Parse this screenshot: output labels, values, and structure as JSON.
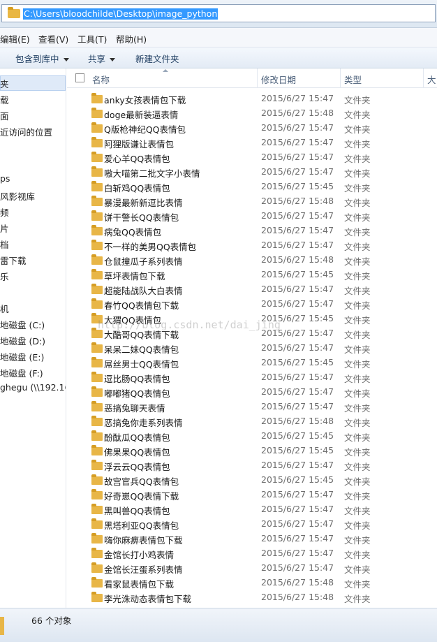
{
  "address": {
    "path": "C:\\Users\\bloodchilde\\Desktop\\image_python"
  },
  "menubar": {
    "items": [
      "编辑(E)",
      "查看(V)",
      "工具(T)",
      "帮助(H)"
    ]
  },
  "toolbar": {
    "include_library": "包含到库中",
    "share": "共享",
    "new_folder": "新建文件夹"
  },
  "navpane": {
    "items": [
      "夹",
      "载",
      "面",
      "近访问的位置",
      "ps",
      "风影视库",
      "频",
      "片",
      "档",
      "雷下载",
      "乐",
      "机",
      "地磁盘 (C:)",
      "地磁盘 (D:)",
      "地磁盘 (E:)",
      "地磁盘 (F:)",
      "ghegu (\\\\192.16"
    ]
  },
  "columns": {
    "name": "名称",
    "date": "修改日期",
    "type": "类型",
    "size": "大"
  },
  "files": [
    {
      "name": "anky女孩表情包下载",
      "date": "2015/6/27 15:47",
      "type": "文件夹"
    },
    {
      "name": "doge最新装逼表情",
      "date": "2015/6/27 15:48",
      "type": "文件夹"
    },
    {
      "name": "Q版枪神纪QQ表情包",
      "date": "2015/6/27 15:47",
      "type": "文件夹"
    },
    {
      "name": "阿狸版谦让表情包",
      "date": "2015/6/27 15:47",
      "type": "文件夹"
    },
    {
      "name": "爱心羊QQ表情包",
      "date": "2015/6/27 15:47",
      "type": "文件夹"
    },
    {
      "name": "嗷大喵第二批文字小表情",
      "date": "2015/6/27 15:47",
      "type": "文件夹"
    },
    {
      "name": "白斩鸡QQ表情包",
      "date": "2015/6/27 15:45",
      "type": "文件夹"
    },
    {
      "name": "暴漫最新新逗比表情",
      "date": "2015/6/27 15:48",
      "type": "文件夹"
    },
    {
      "name": "饼干警长QQ表情包",
      "date": "2015/6/27 15:47",
      "type": "文件夹"
    },
    {
      "name": "病兔QQ表情包",
      "date": "2015/6/27 15:47",
      "type": "文件夹"
    },
    {
      "name": "不一样的美男QQ表情包",
      "date": "2015/6/27 15:47",
      "type": "文件夹"
    },
    {
      "name": "仓鼠撞瓜子系列表情",
      "date": "2015/6/27 15:48",
      "type": "文件夹"
    },
    {
      "name": "草坪表情包下载",
      "date": "2015/6/27 15:45",
      "type": "文件夹"
    },
    {
      "name": "超能陆战队大白表情",
      "date": "2015/6/27 15:47",
      "type": "文件夹"
    },
    {
      "name": "春竹QQ表情包下载",
      "date": "2015/6/27 15:47",
      "type": "文件夹"
    },
    {
      "name": "大猬QQ表情包",
      "date": "2015/6/27 15:45",
      "type": "文件夹"
    },
    {
      "name": "大酷哥QQ表情下载",
      "date": "2015/6/27 15:47",
      "type": "文件夹"
    },
    {
      "name": "呆呆二妹QQ表情包",
      "date": "2015/6/27 15:47",
      "type": "文件夹"
    },
    {
      "name": "屌丝男士QQ表情包",
      "date": "2015/6/27 15:45",
      "type": "文件夹"
    },
    {
      "name": "逗比肠QQ表情包",
      "date": "2015/6/27 15:47",
      "type": "文件夹"
    },
    {
      "name": "嘟嘟猪QQ表情包",
      "date": "2015/6/27 15:47",
      "type": "文件夹"
    },
    {
      "name": "恶搞兔聊天表情",
      "date": "2015/6/27 15:47",
      "type": "文件夹"
    },
    {
      "name": "恶搞兔你走系列表情",
      "date": "2015/6/27 15:48",
      "type": "文件夹"
    },
    {
      "name": "酚酞瓜QQ表情包",
      "date": "2015/6/27 15:45",
      "type": "文件夹"
    },
    {
      "name": "佛果果QQ表情包",
      "date": "2015/6/27 15:45",
      "type": "文件夹"
    },
    {
      "name": "浮云云QQ表情包",
      "date": "2015/6/27 15:47",
      "type": "文件夹"
    },
    {
      "name": "故宫官兵QQ表情包",
      "date": "2015/6/27 15:45",
      "type": "文件夹"
    },
    {
      "name": "好奇崽QQ表情下载",
      "date": "2015/6/27 15:47",
      "type": "文件夹"
    },
    {
      "name": "黑叫兽QQ表情包",
      "date": "2015/6/27 15:47",
      "type": "文件夹"
    },
    {
      "name": "黑塔利亚QQ表情包",
      "date": "2015/6/27 15:47",
      "type": "文件夹"
    },
    {
      "name": "嗨你麻痹表情包下载",
      "date": "2015/6/27 15:47",
      "type": "文件夹"
    },
    {
      "name": "金馆长打小鸡表情",
      "date": "2015/6/27 15:47",
      "type": "文件夹"
    },
    {
      "name": "金馆长汪蛋系列表情",
      "date": "2015/6/27 15:47",
      "type": "文件夹"
    },
    {
      "name": "看家鼠表情包下载",
      "date": "2015/6/27 15:48",
      "type": "文件夹"
    },
    {
      "name": "李光洙动态表情包下载",
      "date": "2015/6/27 15:48",
      "type": "文件夹"
    }
  ],
  "watermark": "http://blog.csdn.net/dai_jing",
  "status": {
    "count": "66 个对象"
  }
}
